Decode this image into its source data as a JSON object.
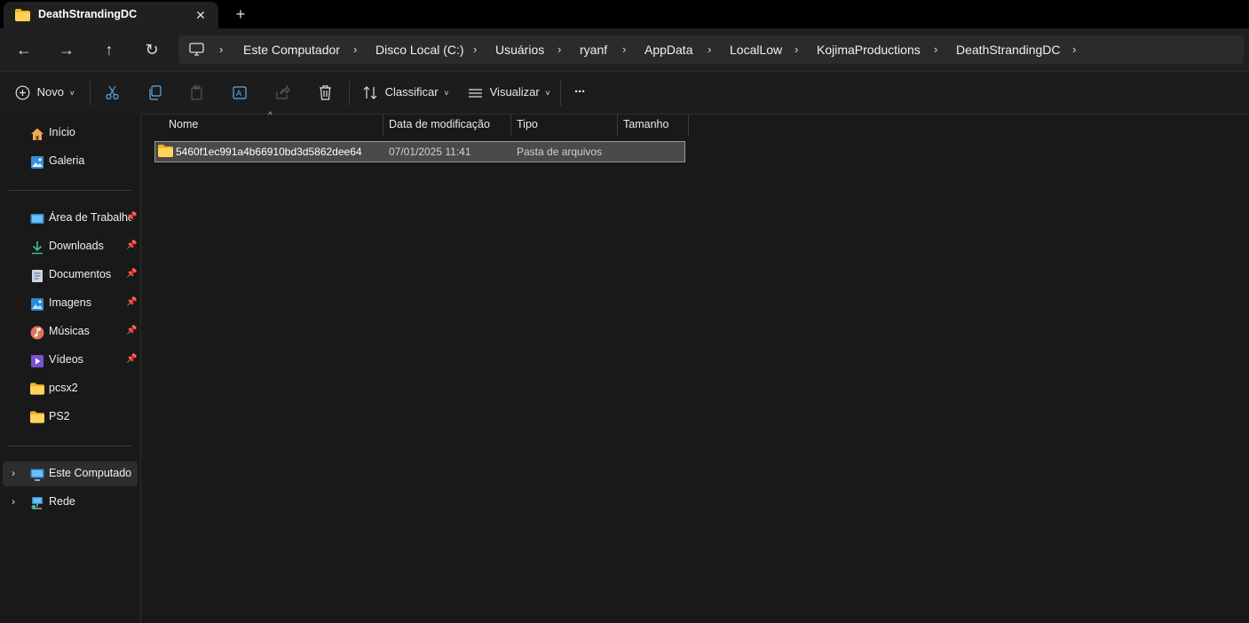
{
  "window": {
    "tab_title": "DeathStrandingDC",
    "close_tab": "✕",
    "new_tab": "+"
  },
  "nav": {
    "back": "←",
    "forward": "→",
    "up": "↑",
    "refresh": "↻"
  },
  "breadcrumb": [
    "Este Computador",
    "Disco Local (C:)",
    "Usuários",
    "ryanf",
    "AppData",
    "LocalLow",
    "KojimaProductions",
    "DeathStrandingDC"
  ],
  "breadcrumb_separator": "›",
  "toolbar": {
    "new_label": "Novo",
    "sort_label": "Classificar",
    "view_label": "Visualizar",
    "more_label": "···"
  },
  "sidebar": {
    "top_items": [
      {
        "label": "Início",
        "icon": "home-icon"
      },
      {
        "label": "Galeria",
        "icon": "gallery-icon"
      }
    ],
    "quick_access": [
      {
        "label": "Área de Trabalho",
        "icon": "desktop-icon",
        "pinned": true
      },
      {
        "label": "Downloads",
        "icon": "download-icon",
        "pinned": true
      },
      {
        "label": "Documentos",
        "icon": "document-icon",
        "pinned": true
      },
      {
        "label": "Imagens",
        "icon": "pictures-icon",
        "pinned": true
      },
      {
        "label": "Músicas",
        "icon": "music-icon",
        "pinned": true
      },
      {
        "label": "Vídeos",
        "icon": "video-icon",
        "pinned": true
      },
      {
        "label": "pcsx2",
        "icon": "folder-icon",
        "pinned": false
      },
      {
        "label": "PS2",
        "icon": "folder-icon",
        "pinned": false
      }
    ],
    "pin_glyph": "📌",
    "expand_glyph": "›",
    "locations": [
      {
        "label": "Este Computador",
        "icon": "computer-icon",
        "selected": true
      },
      {
        "label": "Rede",
        "icon": "network-icon",
        "selected": false
      }
    ]
  },
  "columns": {
    "name": "Nome",
    "date": "Data de modificação",
    "type": "Tipo",
    "size": "Tamanho",
    "sort_indicator": "^"
  },
  "files": [
    {
      "name": "5460f1ec991a4b66910bd3d5862dee64",
      "date": "07/01/2025 11:41",
      "type": "Pasta de arquivos",
      "size": ""
    }
  ],
  "colors": {
    "folder": "#f0b429",
    "background": "#191919",
    "selection": "#4a4a4a"
  }
}
